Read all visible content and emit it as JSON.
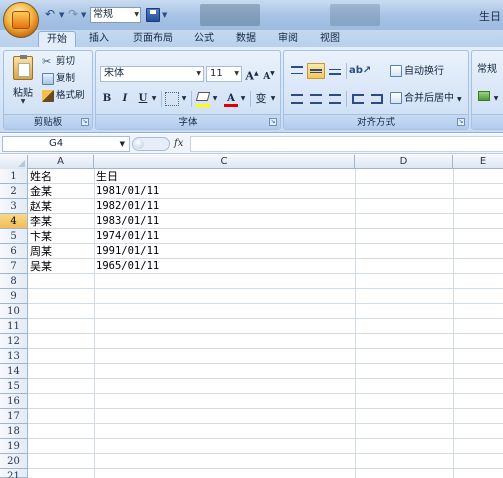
{
  "qat": {
    "undo_icon": "undo-arrow-icon",
    "redo_icon": "redo-arrow-icon",
    "style_value": "常规",
    "save_icon": "save-disk-icon"
  },
  "app_title": "生日",
  "tabs": [
    "开始",
    "插入",
    "页面布局",
    "公式",
    "数据",
    "审阅",
    "视图"
  ],
  "clipboard": {
    "paste": "粘贴",
    "cut": "剪切",
    "copy": "复制",
    "format_painter": "格式刷",
    "label": "剪贴板"
  },
  "font": {
    "name": "宋体",
    "size": "11",
    "grow": "A",
    "shrink": "A",
    "bold": "B",
    "italic": "I",
    "underline": "U",
    "font_color_letter": "A",
    "phonetic": "变",
    "label": "字体"
  },
  "alignment": {
    "wrap_text": "自动换行",
    "merge_center": "合并后居中",
    "label": "对齐方式"
  },
  "number": {
    "format": "常规"
  },
  "name_box": "G4",
  "fx": "fx",
  "columns": [
    "A",
    "C",
    "D",
    "E"
  ],
  "rows": [
    "1",
    "2",
    "3",
    "4",
    "5",
    "6",
    "7",
    "8",
    "9",
    "10",
    "11",
    "12",
    "13",
    "14",
    "15",
    "16",
    "17",
    "18",
    "19",
    "20",
    "21"
  ],
  "selected_row": "4",
  "cells": {
    "header": [
      "姓名",
      "生日"
    ],
    "data": [
      [
        "金某",
        "1981/01/11"
      ],
      [
        "赵某",
        "1982/01/11"
      ],
      [
        "李某",
        "1983/01/11"
      ],
      [
        "卞某",
        "1974/01/11"
      ],
      [
        "周某",
        "1991/01/11"
      ],
      [
        "吴某",
        "1965/01/11"
      ]
    ]
  },
  "colors": {
    "ribbon": "#d6e5f8",
    "active_highlight": "#f3bc55",
    "gridline": "#d2dbe6"
  }
}
